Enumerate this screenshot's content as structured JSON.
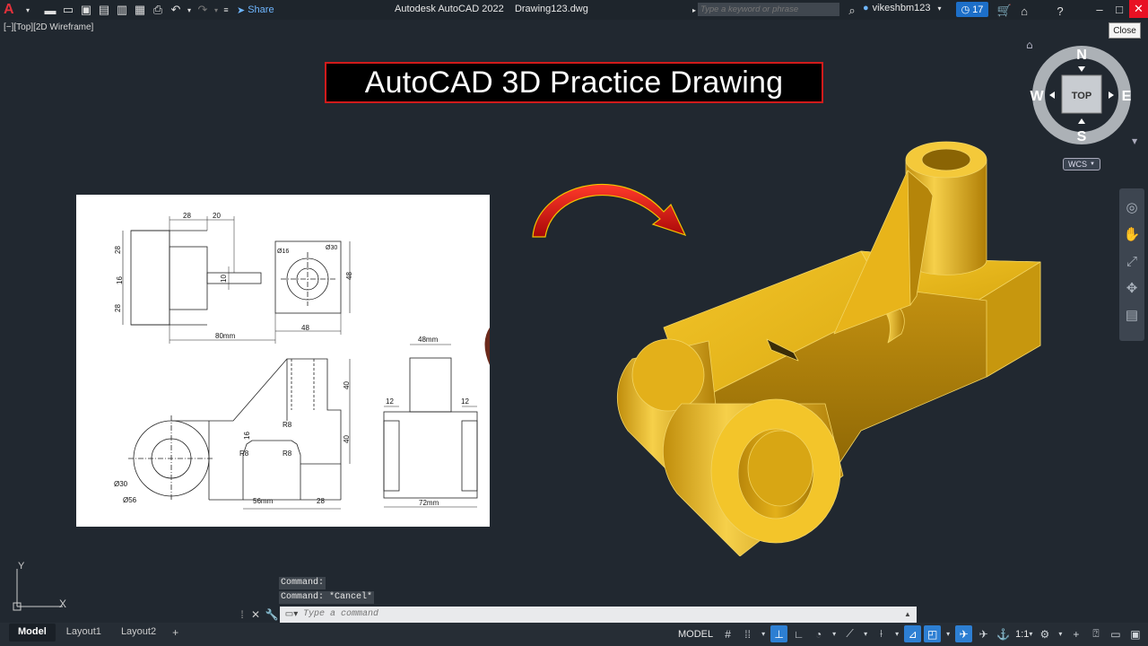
{
  "titlebar": {
    "app_name": "Autodesk AutoCAD 2022",
    "file_name": "Drawing123.dwg",
    "share_label": "Share",
    "search_placeholder": "Type a keyword or phrase",
    "user_name": "vikeshbm123",
    "notification_count": "17",
    "close_tooltip": "Close"
  },
  "viewport": {
    "label": "[−][Top][2D Wireframe]"
  },
  "banner": {
    "title": "AutoCAD 3D Practice Drawing"
  },
  "reference_drawing": {
    "dims": {
      "top_28": "28",
      "top_20": "20",
      "left_28a": "28",
      "left_16": "16",
      "left_28b": "28",
      "hole_d16": "Ø16",
      "hole_d30": "Ø30",
      "slot_10": "10",
      "right_48": "48",
      "bottom_80": "80mm",
      "bottom_48": "48",
      "side_top_48": "48mm",
      "side_12a": "12",
      "side_12b": "12",
      "side_72": "72mm",
      "front_40a": "40",
      "front_40b": "40",
      "front_r8a": "R8",
      "front_r8b": "R8",
      "front_r8c": "R8",
      "front_16": "16",
      "front_d30": "Ø30",
      "front_d56": "Ø56",
      "front_56": "56mm",
      "front_28": "28"
    }
  },
  "viewcube": {
    "north": "N",
    "south": "S",
    "east": "E",
    "west": "W",
    "face": "TOP",
    "wcs": "WCS"
  },
  "ucs": {
    "y_label": "Y",
    "x_label": "X"
  },
  "command": {
    "history": [
      "Command:",
      "Command: *Cancel*"
    ],
    "placeholder": "Type a command"
  },
  "layout_tabs": [
    "Model",
    "Layout1",
    "Layout2"
  ],
  "statusbar": {
    "model_label": "MODEL",
    "scale": "1:1"
  },
  "colors": {
    "background": "#212830",
    "banner_border": "#d11b1b",
    "model_gold": "#e8b41a",
    "arrow_red": "#d40d0d",
    "status_active": "#2d7fd3"
  }
}
